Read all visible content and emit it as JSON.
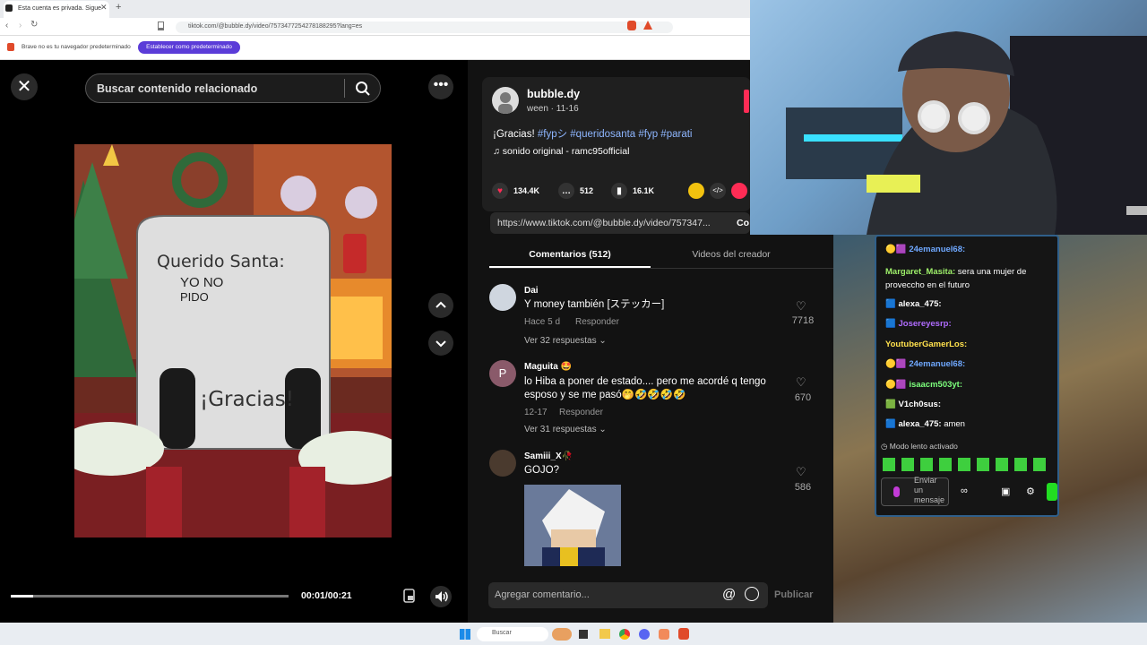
{
  "browser": {
    "tab_title": "Esta cuenta es privada. Sigue",
    "url": "tiktok.com/@bubble.dy/video/7573477254278188295?lang=es",
    "notice_text": "Brave no es tu navegador predeterminado",
    "notice_button": "Establecer como predeterminado"
  },
  "search": {
    "placeholder": "Buscar contenido relacionado"
  },
  "video": {
    "sign_line1": "Querido Santa:",
    "sign_line2": "YO NO",
    "sign_line3": "PIDO",
    "sign_line4": "¡Gracias!",
    "time": "00:01/00:21",
    "progress": 0.08
  },
  "post": {
    "author": "bubble.dy",
    "author_sub": "ween · 11-16",
    "caption_text": "¡Gracias!",
    "hashtags": "#fypシ #queridosanta #fyp #parati",
    "music": "sonido original - ramc95official",
    "likes": "134.4K",
    "comments": "512",
    "saves": "16.1K",
    "link": "https://www.tiktok.com/@bubble.dy/video/757347...",
    "copy": "Co"
  },
  "tabs": {
    "comments": "Comentarios (512)",
    "creator": "Videos del creador"
  },
  "comments": [
    {
      "user": "Dai",
      "text": "Y money también [ステッカー]",
      "meta": "Hace 5 d",
      "reply": "Responder",
      "more": "Ver 32 respuestas",
      "likes": "7718"
    },
    {
      "user": "Maguita 🤩",
      "text": "lo Hiba a poner de estado.... pero me acordé q tengo esposo y se me pasó🤭🤣🤣🤣🤣",
      "meta": "12-17",
      "reply": "Responder",
      "more": "Ver 31 respuestas",
      "likes": "670"
    },
    {
      "user": "Samiii_X🥀",
      "text": "GOJO?",
      "likes": "586"
    }
  ],
  "add_comment": {
    "placeholder": "Agregar comentario...",
    "publish": "Publicar"
  },
  "chat": {
    "lines": [
      {
        "user": "24emanuel68:",
        "msg": "",
        "color": "#6fa8ff"
      },
      {
        "user": "Margaret_Masita:",
        "msg": "sera una mujer de proveccho en el futuro",
        "color": "#9ef06a"
      },
      {
        "user": "alexa_475:",
        "msg": "",
        "color": "#ffffff"
      },
      {
        "user": "Josereyesrp:",
        "msg": "",
        "color": "#b06cff"
      },
      {
        "user": "YoutuberGamerLos:",
        "msg": "",
        "color": "#ffe14d"
      },
      {
        "user": "24emanuel68:",
        "msg": "",
        "color": "#6fa8ff"
      },
      {
        "user": "isaacm503yt:",
        "msg": "",
        "color": "#7cff7c"
      },
      {
        "user": "V1ch0sus:",
        "msg": "",
        "color": "#ffffff"
      },
      {
        "user": "alexa_475:",
        "msg": "amen",
        "color": "#ffffff"
      }
    ],
    "slow_mode": "Modo lento activado",
    "send": "Enviar un mensaje"
  },
  "taskbar": {
    "search": "Buscar"
  }
}
